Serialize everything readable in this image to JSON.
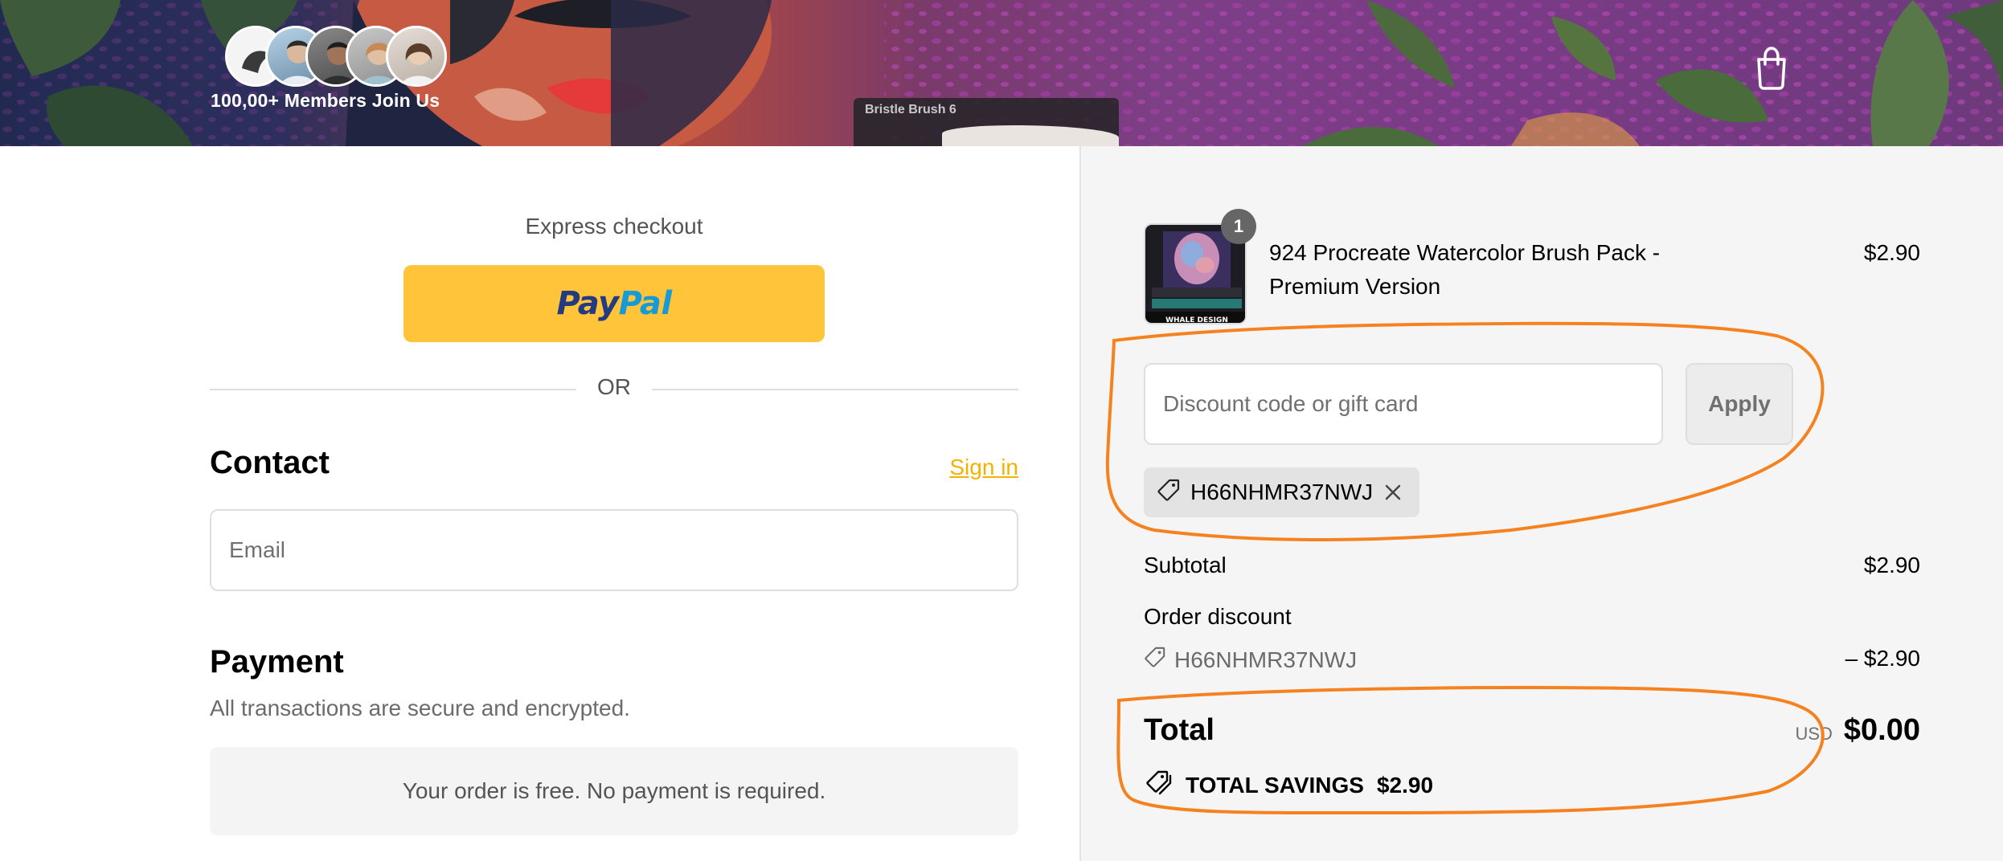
{
  "header": {
    "members_label": "100,00+ Members Join Us",
    "brush_chip_label": "Bristle Brush 6",
    "cart_icon": "shopping-bag-icon"
  },
  "checkout": {
    "express_label": "Express checkout",
    "paypal_label": {
      "pay": "Pay",
      "pal": "Pal"
    },
    "or_label": "OR",
    "contact_title": "Contact",
    "sign_in_label": "Sign in",
    "email_placeholder": "Email",
    "payment_title": "Payment",
    "payment_subtitle": "All transactions are secure and encrypted.",
    "free_notice": "Your order is free. No payment is required."
  },
  "summary": {
    "product": {
      "quantity": "1",
      "name": "924 Procreate Watercolor Brush Pack - Premium Version",
      "price": "$2.90",
      "thumbnail_caption": "WHALE DESIGN"
    },
    "discount_placeholder": "Discount code or gift card",
    "apply_label": "Apply",
    "applied_code": "H66NHMR37NWJ",
    "subtotal_label": "Subtotal",
    "subtotal_value": "$2.90",
    "order_discount_label": "Order discount",
    "discount_code": "H66NHMR37NWJ",
    "discount_value": "– $2.90",
    "total_label": "Total",
    "currency": "USD",
    "total_value": "$0.00",
    "savings_label": "TOTAL SAVINGS",
    "savings_value": "$2.90"
  },
  "colors": {
    "paypal_yellow": "#ffc439",
    "paypal_dark": "#253b80",
    "paypal_light": "#179bd7",
    "sign_in_link": "#f0b400",
    "annotation_orange": "#f5821f",
    "summary_bg": "#f5f5f5"
  }
}
